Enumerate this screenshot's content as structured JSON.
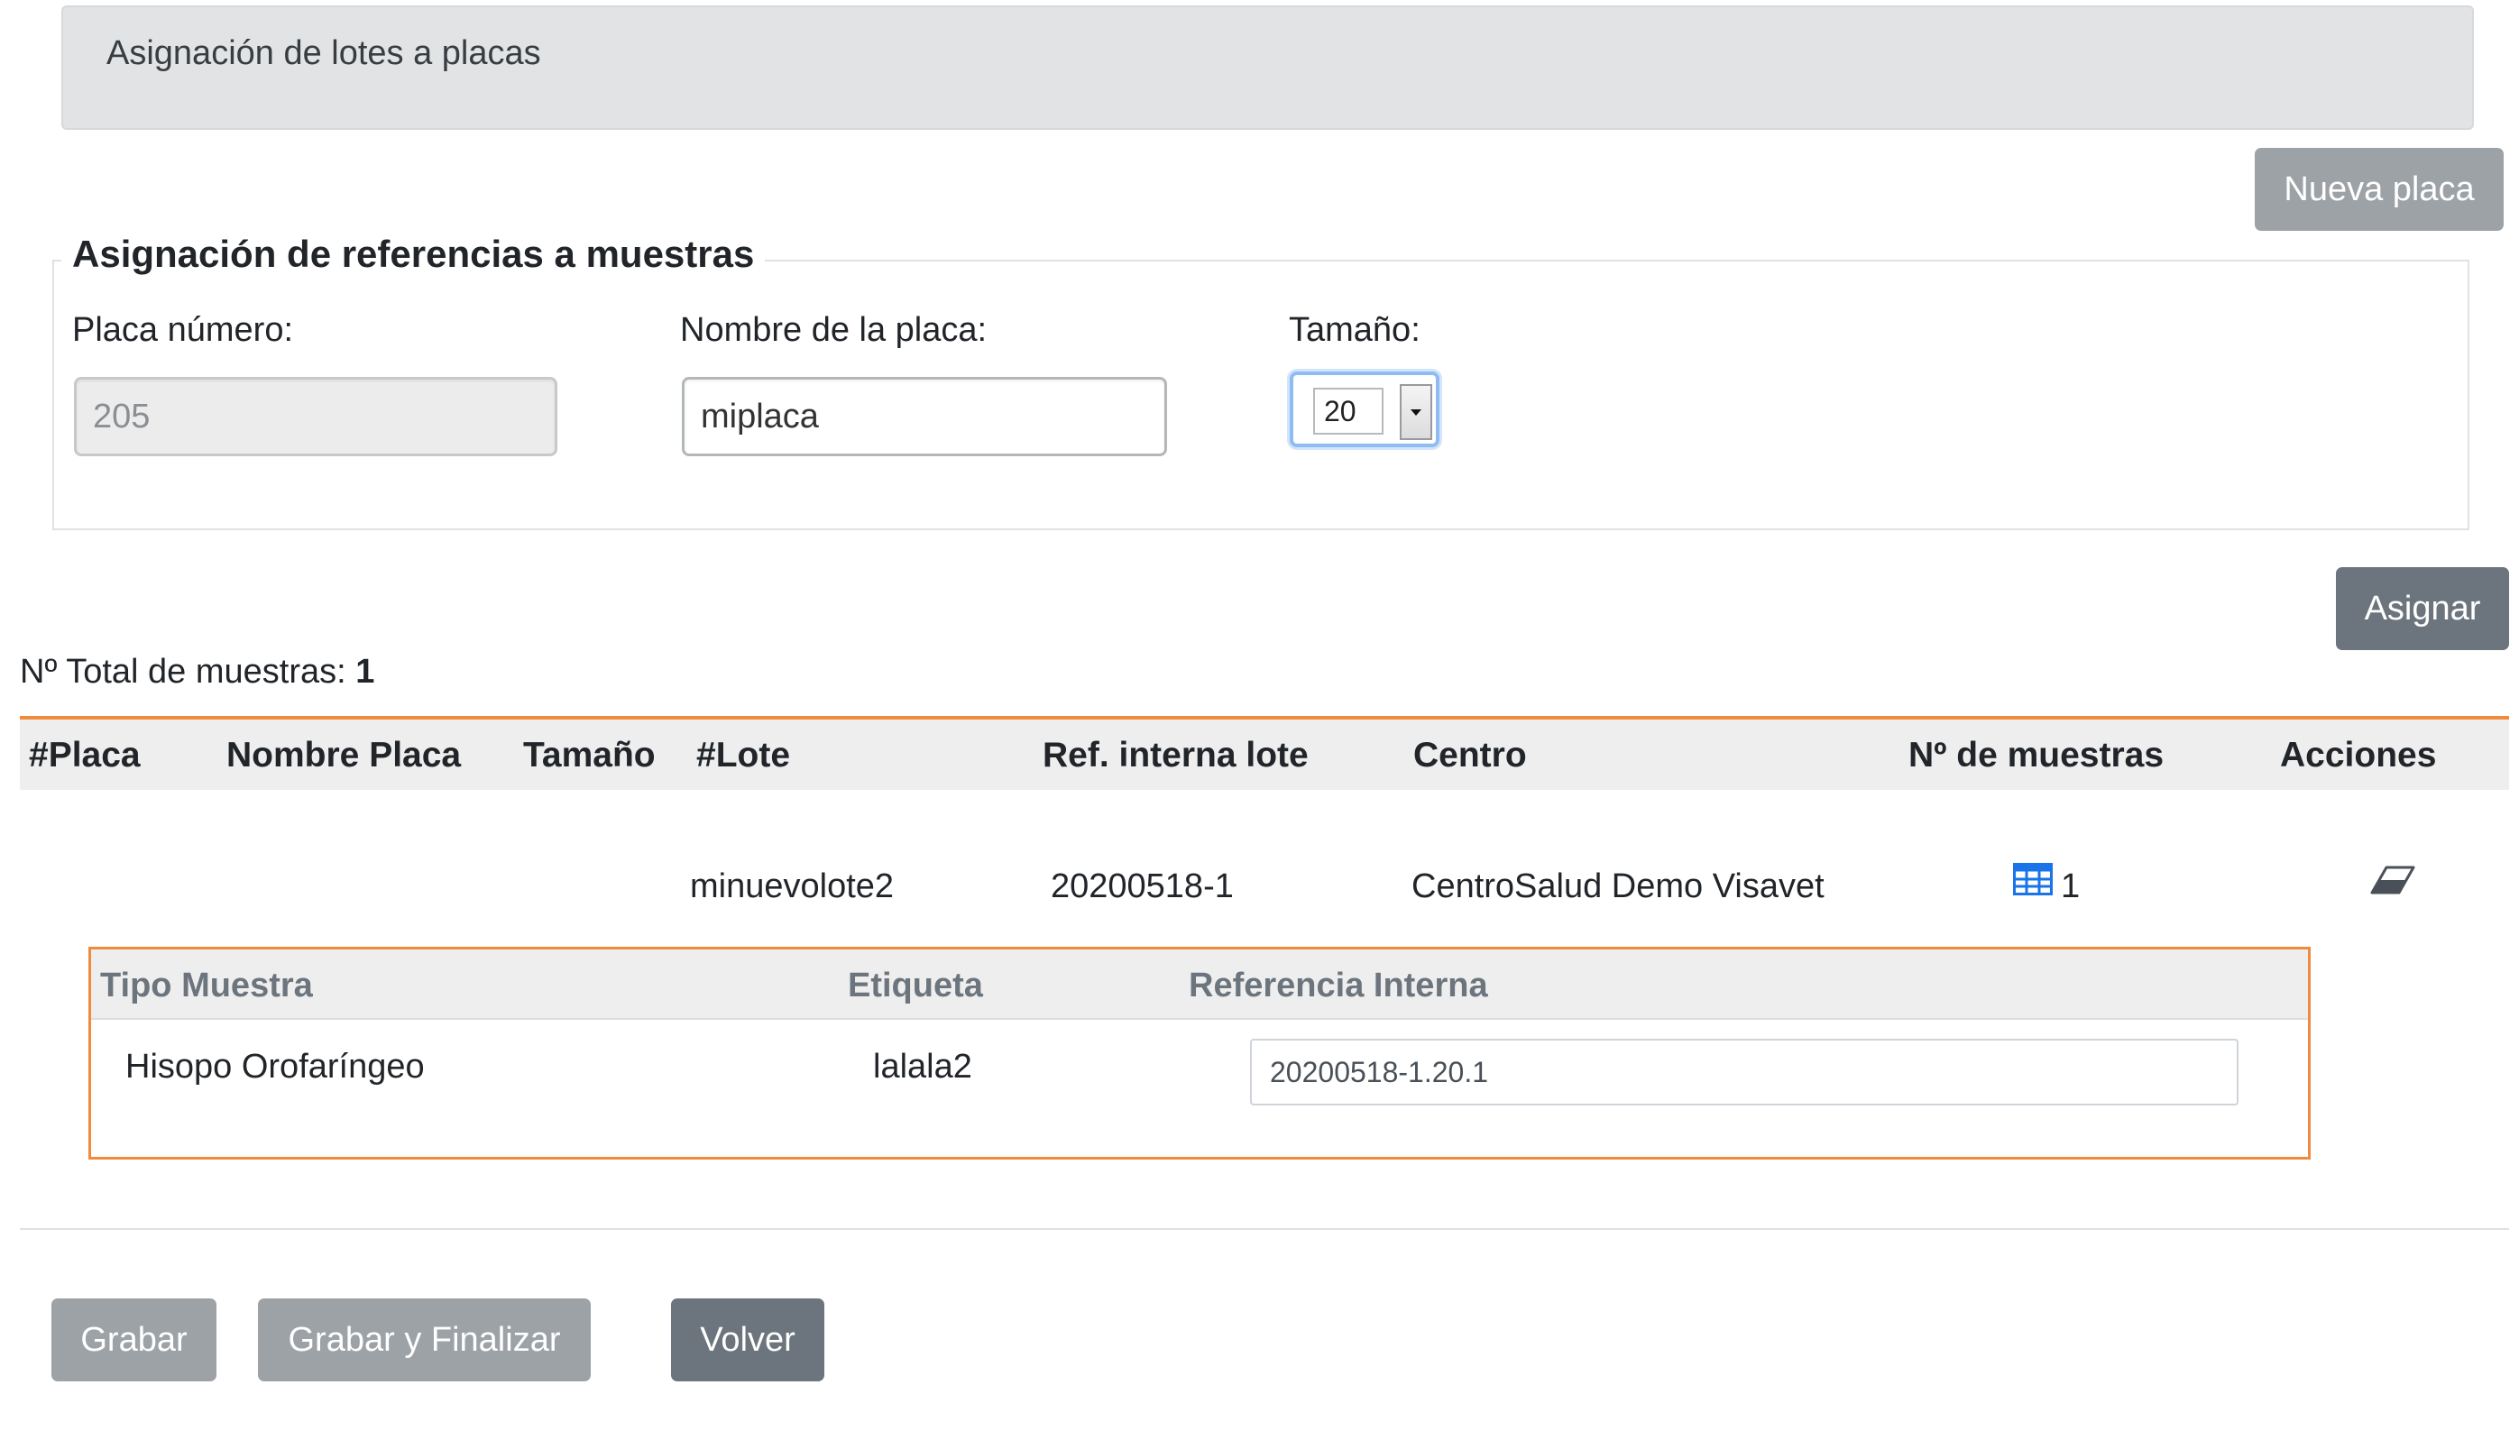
{
  "header": {
    "title": "Asignación de lotes a placas"
  },
  "toolbar": {
    "new_plate_label": "Nueva placa",
    "assign_label": "Asignar"
  },
  "plate_form": {
    "legend": "Asignación de referencias a muestras",
    "plate_number_label": "Placa número:",
    "plate_number_value": "205",
    "plate_name_label": "Nombre de la placa:",
    "plate_name_value": "miplaca",
    "size_label": "Tamaño:",
    "size_value": "20"
  },
  "summary": {
    "total_label": "Nº Total de muestras:",
    "total_value": "1"
  },
  "table": {
    "headers": [
      "#Placa",
      "Nombre Placa",
      "Tamaño",
      "#Lote",
      "Ref. interna lote",
      "Centro",
      "Nº de muestras",
      "Acciones"
    ],
    "rows": [
      {
        "placa": "",
        "nombre_placa": "",
        "tamano": "",
        "lote": "minuevolote2",
        "ref_interna": "20200518-1",
        "centro": "CentroSalud Demo Visavet",
        "n_muestras": "1",
        "samples_icon": "table-grid-icon",
        "action_icon": "eraser-icon"
      }
    ]
  },
  "sub_table": {
    "headers": [
      "Tipo Muestra",
      "Etiqueta",
      "Referencia Interna"
    ],
    "rows": [
      {
        "tipo": "Hisopo Orofaríngeo",
        "etiqueta": "lalala2",
        "referencia": "20200518-1.20.1"
      }
    ]
  },
  "footer": {
    "save_label": "Grabar",
    "save_finish_label": "Grabar y Finalizar",
    "back_label": "Volver"
  },
  "colors": {
    "accent_orange": "#f08a3c",
    "icon_blue": "#1a73e8",
    "button_disabled": "#9da2a7",
    "button_secondary": "#6c757d"
  }
}
